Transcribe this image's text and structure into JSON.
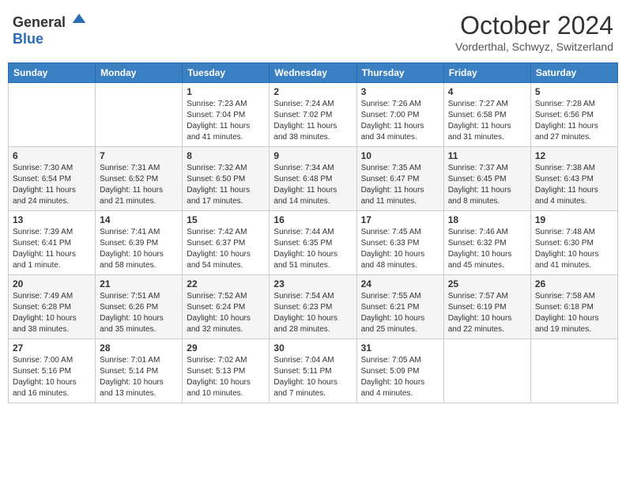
{
  "header": {
    "logo_general": "General",
    "logo_blue": "Blue",
    "title": "October 2024",
    "location": "Vorderthal, Schwyz, Switzerland"
  },
  "days_of_week": [
    "Sunday",
    "Monday",
    "Tuesday",
    "Wednesday",
    "Thursday",
    "Friday",
    "Saturday"
  ],
  "weeks": [
    [
      {
        "day": "",
        "info": ""
      },
      {
        "day": "",
        "info": ""
      },
      {
        "day": "1",
        "info": "Sunrise: 7:23 AM\nSunset: 7:04 PM\nDaylight: 11 hours and 41 minutes."
      },
      {
        "day": "2",
        "info": "Sunrise: 7:24 AM\nSunset: 7:02 PM\nDaylight: 11 hours and 38 minutes."
      },
      {
        "day": "3",
        "info": "Sunrise: 7:26 AM\nSunset: 7:00 PM\nDaylight: 11 hours and 34 minutes."
      },
      {
        "day": "4",
        "info": "Sunrise: 7:27 AM\nSunset: 6:58 PM\nDaylight: 11 hours and 31 minutes."
      },
      {
        "day": "5",
        "info": "Sunrise: 7:28 AM\nSunset: 6:56 PM\nDaylight: 11 hours and 27 minutes."
      }
    ],
    [
      {
        "day": "6",
        "info": "Sunrise: 7:30 AM\nSunset: 6:54 PM\nDaylight: 11 hours and 24 minutes."
      },
      {
        "day": "7",
        "info": "Sunrise: 7:31 AM\nSunset: 6:52 PM\nDaylight: 11 hours and 21 minutes."
      },
      {
        "day": "8",
        "info": "Sunrise: 7:32 AM\nSunset: 6:50 PM\nDaylight: 11 hours and 17 minutes."
      },
      {
        "day": "9",
        "info": "Sunrise: 7:34 AM\nSunset: 6:48 PM\nDaylight: 11 hours and 14 minutes."
      },
      {
        "day": "10",
        "info": "Sunrise: 7:35 AM\nSunset: 6:47 PM\nDaylight: 11 hours and 11 minutes."
      },
      {
        "day": "11",
        "info": "Sunrise: 7:37 AM\nSunset: 6:45 PM\nDaylight: 11 hours and 8 minutes."
      },
      {
        "day": "12",
        "info": "Sunrise: 7:38 AM\nSunset: 6:43 PM\nDaylight: 11 hours and 4 minutes."
      }
    ],
    [
      {
        "day": "13",
        "info": "Sunrise: 7:39 AM\nSunset: 6:41 PM\nDaylight: 11 hours and 1 minute."
      },
      {
        "day": "14",
        "info": "Sunrise: 7:41 AM\nSunset: 6:39 PM\nDaylight: 10 hours and 58 minutes."
      },
      {
        "day": "15",
        "info": "Sunrise: 7:42 AM\nSunset: 6:37 PM\nDaylight: 10 hours and 54 minutes."
      },
      {
        "day": "16",
        "info": "Sunrise: 7:44 AM\nSunset: 6:35 PM\nDaylight: 10 hours and 51 minutes."
      },
      {
        "day": "17",
        "info": "Sunrise: 7:45 AM\nSunset: 6:33 PM\nDaylight: 10 hours and 48 minutes."
      },
      {
        "day": "18",
        "info": "Sunrise: 7:46 AM\nSunset: 6:32 PM\nDaylight: 10 hours and 45 minutes."
      },
      {
        "day": "19",
        "info": "Sunrise: 7:48 AM\nSunset: 6:30 PM\nDaylight: 10 hours and 41 minutes."
      }
    ],
    [
      {
        "day": "20",
        "info": "Sunrise: 7:49 AM\nSunset: 6:28 PM\nDaylight: 10 hours and 38 minutes."
      },
      {
        "day": "21",
        "info": "Sunrise: 7:51 AM\nSunset: 6:26 PM\nDaylight: 10 hours and 35 minutes."
      },
      {
        "day": "22",
        "info": "Sunrise: 7:52 AM\nSunset: 6:24 PM\nDaylight: 10 hours and 32 minutes."
      },
      {
        "day": "23",
        "info": "Sunrise: 7:54 AM\nSunset: 6:23 PM\nDaylight: 10 hours and 28 minutes."
      },
      {
        "day": "24",
        "info": "Sunrise: 7:55 AM\nSunset: 6:21 PM\nDaylight: 10 hours and 25 minutes."
      },
      {
        "day": "25",
        "info": "Sunrise: 7:57 AM\nSunset: 6:19 PM\nDaylight: 10 hours and 22 minutes."
      },
      {
        "day": "26",
        "info": "Sunrise: 7:58 AM\nSunset: 6:18 PM\nDaylight: 10 hours and 19 minutes."
      }
    ],
    [
      {
        "day": "27",
        "info": "Sunrise: 7:00 AM\nSunset: 5:16 PM\nDaylight: 10 hours and 16 minutes."
      },
      {
        "day": "28",
        "info": "Sunrise: 7:01 AM\nSunset: 5:14 PM\nDaylight: 10 hours and 13 minutes."
      },
      {
        "day": "29",
        "info": "Sunrise: 7:02 AM\nSunset: 5:13 PM\nDaylight: 10 hours and 10 minutes."
      },
      {
        "day": "30",
        "info": "Sunrise: 7:04 AM\nSunset: 5:11 PM\nDaylight: 10 hours and 7 minutes."
      },
      {
        "day": "31",
        "info": "Sunrise: 7:05 AM\nSunset: 5:09 PM\nDaylight: 10 hours and 4 minutes."
      },
      {
        "day": "",
        "info": ""
      },
      {
        "day": "",
        "info": ""
      }
    ]
  ]
}
